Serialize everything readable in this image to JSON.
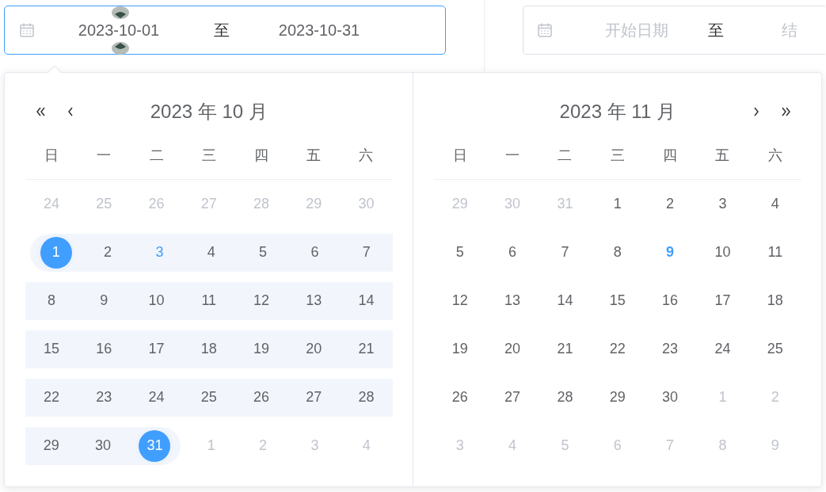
{
  "range_inputs": [
    {
      "active": true,
      "start": {
        "value": "2023-10-01"
      },
      "separator": "至",
      "end": {
        "value": "2023-10-31"
      }
    },
    {
      "active": false,
      "start": {
        "placeholder": "开始日期"
      },
      "separator": "至",
      "end": {
        "placeholder": "结"
      }
    }
  ],
  "calendar": {
    "panels": [
      {
        "title": "2023 年 10 月",
        "nav": [
          {
            "kind": "prev_year"
          },
          {
            "kind": "prev_month"
          }
        ],
        "weekdays": [
          "日",
          "一",
          "二",
          "三",
          "四",
          "五",
          "六"
        ],
        "rows": [
          [
            {
              "text": "24",
              "kind": "other",
              "in_range": false
            },
            {
              "text": "25",
              "kind": "other",
              "in_range": false
            },
            {
              "text": "26",
              "kind": "other",
              "in_range": false
            },
            {
              "text": "27",
              "kind": "other",
              "in_range": false
            },
            {
              "text": "28",
              "kind": "other",
              "in_range": false
            },
            {
              "text": "29",
              "kind": "other",
              "in_range": false
            },
            {
              "text": "30",
              "kind": "other",
              "in_range": false
            }
          ],
          [
            {
              "text": "1",
              "kind": "start",
              "in_range": true
            },
            {
              "text": "2",
              "kind": "normal",
              "in_range": true
            },
            {
              "text": "3",
              "kind": "today",
              "in_range": true
            },
            {
              "text": "4",
              "kind": "normal",
              "in_range": true
            },
            {
              "text": "5",
              "kind": "normal",
              "in_range": true
            },
            {
              "text": "6",
              "kind": "normal",
              "in_range": true
            },
            {
              "text": "7",
              "kind": "normal",
              "in_range": true
            }
          ],
          [
            {
              "text": "8",
              "kind": "normal",
              "in_range": true
            },
            {
              "text": "9",
              "kind": "normal",
              "in_range": true
            },
            {
              "text": "10",
              "kind": "normal",
              "in_range": true
            },
            {
              "text": "11",
              "kind": "normal",
              "in_range": true
            },
            {
              "text": "12",
              "kind": "normal",
              "in_range": true
            },
            {
              "text": "13",
              "kind": "normal",
              "in_range": true
            },
            {
              "text": "14",
              "kind": "normal",
              "in_range": true
            }
          ],
          [
            {
              "text": "15",
              "kind": "normal",
              "in_range": true
            },
            {
              "text": "16",
              "kind": "normal",
              "in_range": true
            },
            {
              "text": "17",
              "kind": "normal",
              "in_range": true
            },
            {
              "text": "18",
              "kind": "normal",
              "in_range": true
            },
            {
              "text": "19",
              "kind": "normal",
              "in_range": true
            },
            {
              "text": "20",
              "kind": "normal",
              "in_range": true
            },
            {
              "text": "21",
              "kind": "normal",
              "in_range": true
            }
          ],
          [
            {
              "text": "22",
              "kind": "normal",
              "in_range": true
            },
            {
              "text": "23",
              "kind": "normal",
              "in_range": true
            },
            {
              "text": "24",
              "kind": "normal",
              "in_range": true
            },
            {
              "text": "25",
              "kind": "normal",
              "in_range": true
            },
            {
              "text": "26",
              "kind": "normal",
              "in_range": true
            },
            {
              "text": "27",
              "kind": "normal",
              "in_range": true
            },
            {
              "text": "28",
              "kind": "normal",
              "in_range": true
            }
          ],
          [
            {
              "text": "29",
              "kind": "normal",
              "in_range": true
            },
            {
              "text": "30",
              "kind": "normal",
              "in_range": true
            },
            {
              "text": "31",
              "kind": "end",
              "in_range": true
            },
            {
              "text": "1",
              "kind": "other",
              "in_range": false
            },
            {
              "text": "2",
              "kind": "other",
              "in_range": false
            },
            {
              "text": "3",
              "kind": "other",
              "in_range": false
            },
            {
              "text": "4",
              "kind": "other",
              "in_range": false
            }
          ]
        ]
      },
      {
        "title": "2023 年 11 月",
        "nav": [
          {
            "kind": "next_month"
          },
          {
            "kind": "next_year"
          }
        ],
        "weekdays": [
          "日",
          "一",
          "二",
          "三",
          "四",
          "五",
          "六"
        ],
        "rows": [
          [
            {
              "text": "29",
              "kind": "other",
              "in_range": false
            },
            {
              "text": "30",
              "kind": "other",
              "in_range": false
            },
            {
              "text": "31",
              "kind": "other",
              "in_range": false
            },
            {
              "text": "1",
              "kind": "normal",
              "in_range": false
            },
            {
              "text": "2",
              "kind": "normal",
              "in_range": false
            },
            {
              "text": "3",
              "kind": "normal",
              "in_range": false
            },
            {
              "text": "4",
              "kind": "normal",
              "in_range": false
            }
          ],
          [
            {
              "text": "5",
              "kind": "normal",
              "in_range": false
            },
            {
              "text": "6",
              "kind": "normal",
              "in_range": false
            },
            {
              "text": "7",
              "kind": "normal",
              "in_range": false
            },
            {
              "text": "8",
              "kind": "normal",
              "in_range": false
            },
            {
              "text": "9",
              "kind": "current",
              "in_range": false
            },
            {
              "text": "10",
              "kind": "normal",
              "in_range": false
            },
            {
              "text": "11",
              "kind": "normal",
              "in_range": false
            }
          ],
          [
            {
              "text": "12",
              "kind": "normal",
              "in_range": false
            },
            {
              "text": "13",
              "kind": "normal",
              "in_range": false
            },
            {
              "text": "14",
              "kind": "normal",
              "in_range": false
            },
            {
              "text": "15",
              "kind": "normal",
              "in_range": false
            },
            {
              "text": "16",
              "kind": "normal",
              "in_range": false
            },
            {
              "text": "17",
              "kind": "normal",
              "in_range": false
            },
            {
              "text": "18",
              "kind": "normal",
              "in_range": false
            }
          ],
          [
            {
              "text": "19",
              "kind": "normal",
              "in_range": false
            },
            {
              "text": "20",
              "kind": "normal",
              "in_range": false
            },
            {
              "text": "21",
              "kind": "normal",
              "in_range": false
            },
            {
              "text": "22",
              "kind": "normal",
              "in_range": false
            },
            {
              "text": "23",
              "kind": "normal",
              "in_range": false
            },
            {
              "text": "24",
              "kind": "normal",
              "in_range": false
            },
            {
              "text": "25",
              "kind": "normal",
              "in_range": false
            }
          ],
          [
            {
              "text": "26",
              "kind": "normal",
              "in_range": false
            },
            {
              "text": "27",
              "kind": "normal",
              "in_range": false
            },
            {
              "text": "28",
              "kind": "normal",
              "in_range": false
            },
            {
              "text": "29",
              "kind": "normal",
              "in_range": false
            },
            {
              "text": "30",
              "kind": "normal",
              "in_range": false
            },
            {
              "text": "1",
              "kind": "other",
              "in_range": false
            },
            {
              "text": "2",
              "kind": "other",
              "in_range": false
            }
          ],
          [
            {
              "text": "3",
              "kind": "other",
              "in_range": false
            },
            {
              "text": "4",
              "kind": "other",
              "in_range": false
            },
            {
              "text": "5",
              "kind": "other",
              "in_range": false
            },
            {
              "text": "6",
              "kind": "other",
              "in_range": false
            },
            {
              "text": "7",
              "kind": "other",
              "in_range": false
            },
            {
              "text": "8",
              "kind": "other",
              "in_range": false
            },
            {
              "text": "9",
              "kind": "other",
              "in_range": false
            }
          ]
        ]
      }
    ]
  }
}
